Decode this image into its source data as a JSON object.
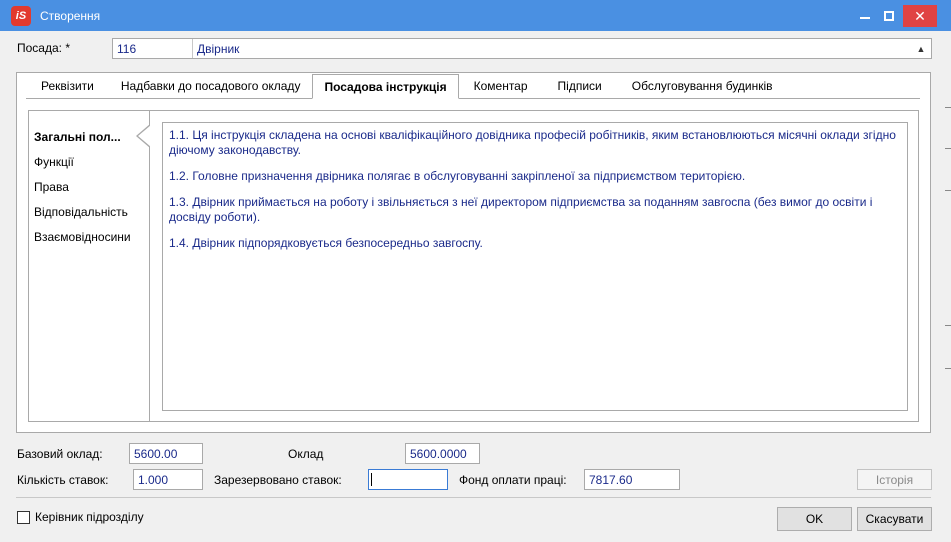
{
  "window": {
    "title": "Створення",
    "logo_text": "iS"
  },
  "header": {
    "position_label": "Посада: *",
    "position_code": "116",
    "position_name": "Двірник"
  },
  "tabs": [
    {
      "label": "Реквізити"
    },
    {
      "label": "Надбавки до посадового окладу"
    },
    {
      "label": "Посадова інструкція"
    },
    {
      "label": "Коментар"
    },
    {
      "label": "Підписи"
    },
    {
      "label": "Обслуговування будинків"
    }
  ],
  "sections": [
    {
      "label": "Загальні пол..."
    },
    {
      "label": "Функції"
    },
    {
      "label": "Права"
    },
    {
      "label": "Відповідальність"
    },
    {
      "label": "Взаємовідносини"
    }
  ],
  "instruction_text": [
    "1.1. Ця інструкція складена на основі кваліфікаційного довідника професій робітників, яким встановлюються місячні оклади згідно діючому законодавству.",
    "1.2. Головне призначення двірника полягає в обслуговуванні закріпленої за підприємством територією.",
    "1.3. Двірник приймається на роботу і звільняється з неї директором підприємства за поданням завгоспа (без вимог до освіти і досвіду роботи).",
    "1.4. Двірник підпорядковується безпосередньо завгоспу."
  ],
  "fields": {
    "base_salary_label": "Базовий оклад:",
    "base_salary_value": "5600.00",
    "salary_label": "Оклад",
    "salary_value": "5600.0000",
    "rates_label": "Кількість ставок:",
    "rates_value": "1.000",
    "reserved_label": "Зарезервовано ставок:",
    "reserved_value": "",
    "fund_label": "Фонд оплати праці:",
    "fund_value": "7817.60"
  },
  "buttons": {
    "history": "Історія",
    "ok": "OK",
    "cancel": "Скасувати"
  },
  "checkbox": {
    "head_of_unit_label": "Керівник підрозділу",
    "checked": false
  },
  "colors": {
    "titlebar": "#4a90e2",
    "close_button": "#e04343",
    "value_text": "#1a2a8a",
    "logo": "#e23a2e"
  }
}
